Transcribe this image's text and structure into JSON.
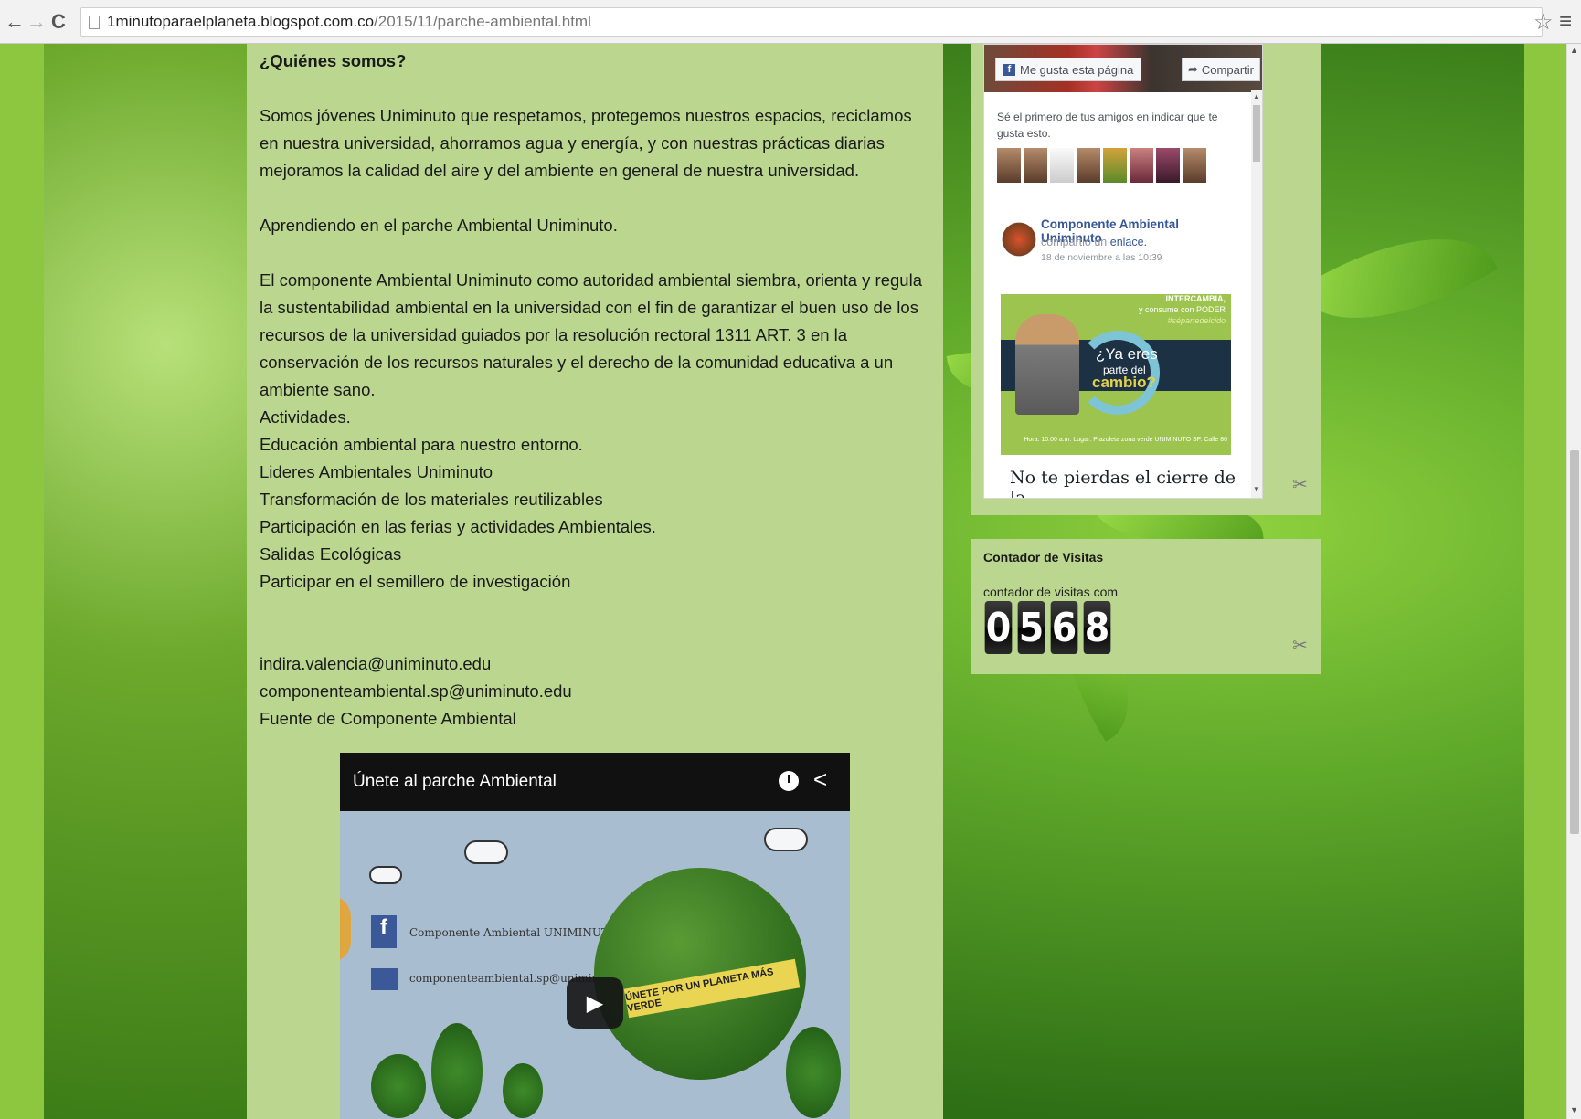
{
  "browser": {
    "back_icon": "←",
    "forward_icon": "→",
    "reload_icon": "C",
    "url_host": "1minutoparaelplaneta.blogspot.com.co",
    "url_path": "/2015/11/parche-ambiental.html",
    "star_icon": "☆",
    "menu_icon": "≡"
  },
  "post": {
    "heading": "¿Quiénes somos?",
    "paragraph1": "Somos jóvenes Uniminuto  que respetamos, protegemos nuestros espacios, reciclamos en nuestra universidad, ahorramos agua y energía, y con nuestras prácticas diarias mejoramos la calidad del aire y del ambiente en general de nuestra universidad.",
    "paragraph2": "Aprendiendo en el parche Ambiental Uniminuto.",
    "paragraph3": "El componente Ambiental Uniminuto  como autoridad ambiental  siembra, orienta y regula la sustentabilidad ambiental en la universidad con el fin de garantizar  el buen uso de los recursos de la universidad guiados por la resolución rectoral 1311 ART. 3 en  la conservación de los recursos naturales y el derecho de la comunidad educativa  a un ambiente sano.",
    "activities_title": "Actividades.",
    "activities": [
      "Educación ambiental para nuestro entorno.",
      "Lideres Ambientales Uniminuto",
      "Transformación de los materiales reutilizables",
      "Participación en las ferias y actividades Ambientales.",
      "Salidas Ecológicas",
      "Participar en el semillero de investigación"
    ],
    "contacts": [
      "indira.valencia@uniminuto.edu",
      "componenteambiental.sp@uniminuto.edu",
      "Fuente de Componente Ambiental"
    ]
  },
  "video": {
    "title": "Únete al parche Ambiental",
    "fb_line": "Componente Ambiental UNIMINUTO",
    "mail_line": "componenteambiental.sp@uniminuto.edu",
    "banner": "ÚNETE POR UN PLANETA MÁS VERDE",
    "play_icon": "▶",
    "share_icon": "<"
  },
  "facebook": {
    "like_label": "Me gusta esta página",
    "share_label": "Compartir",
    "friends_text": "Sé el primero de tus amigos en indicar que te gusta esto.",
    "post_author": "Componente Ambiental Uniminuto",
    "post_action": "compartió un",
    "post_action_link": "enlace.",
    "post_time": "18 de noviembre a las 10:39",
    "image_promo_top": "INTERCAMBIA,",
    "image_promo_sub": "y consume con PODER",
    "image_promo_tag": "#sépartedelcido",
    "image_big1": "¿Ya eres",
    "image_big2": "parte del",
    "image_big3": "cambio?",
    "image_fine": "Hora: 10:00 a.m.  Lugar: Plazoleta zona verde UNIMINUTO SP. Calle 80",
    "post_title": "No te pierdas el cierre de la"
  },
  "counter": {
    "title": "Contador de Visitas",
    "label": "contador de visitas com",
    "digits": [
      "0",
      "5",
      "6",
      "8"
    ]
  },
  "colors": {
    "main_panel": "#bbd78f",
    "gutter": "#8dc63f",
    "fb_blue": "#3b5998"
  }
}
